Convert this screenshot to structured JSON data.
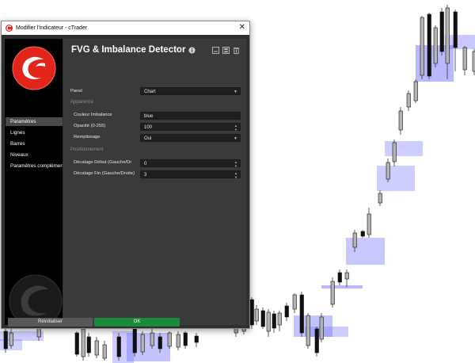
{
  "window": {
    "title": "Modifier l'indicateur - cTrader"
  },
  "indicator": {
    "title": "FVG & Imbalance Detector"
  },
  "colors": {
    "fvg_box": "#6f6fff",
    "candle_bull": "#b4b4b4",
    "candle_bear": "#111111",
    "ok_button": "#1b8a3c",
    "dialog_bg": "#3a3a3a",
    "sidebar_bg": "#000000",
    "accent": "#e1251b"
  },
  "sidebar": {
    "items": [
      {
        "label": "Paramètres",
        "active": true
      },
      {
        "label": "Lignes",
        "active": false
      },
      {
        "label": "Barres",
        "active": false
      },
      {
        "label": "Niveaux",
        "active": false
      },
      {
        "label": "Paramètres complémentaires",
        "active": false
      }
    ]
  },
  "fields": {
    "panel": {
      "label": "Panel",
      "value": "Chart"
    },
    "section_appearance": "Apparence",
    "imbalance_color": {
      "label": "Couleur Imbalance",
      "value": "blue"
    },
    "opacity": {
      "label": "Opacité (0-255)",
      "value": "100"
    },
    "fill": {
      "label": "Remplissage",
      "value": "Oui"
    },
    "section_positioning": "Positionnement",
    "start_offset": {
      "label": "Décalage Début (Gauche/Dr",
      "value": "0"
    },
    "end_offset": {
      "label": "Décalage Fin (Gauche/Droite)",
      "value": "3"
    }
  },
  "buttons": {
    "reset": "Réinitialiser",
    "ok": "OK"
  },
  "icons": {
    "app": "ctrader-logo-icon",
    "close": "close-icon",
    "info": "info-icon",
    "header_buttons": [
      "minimize-icon",
      "save-icon",
      "delete-icon"
    ]
  }
}
